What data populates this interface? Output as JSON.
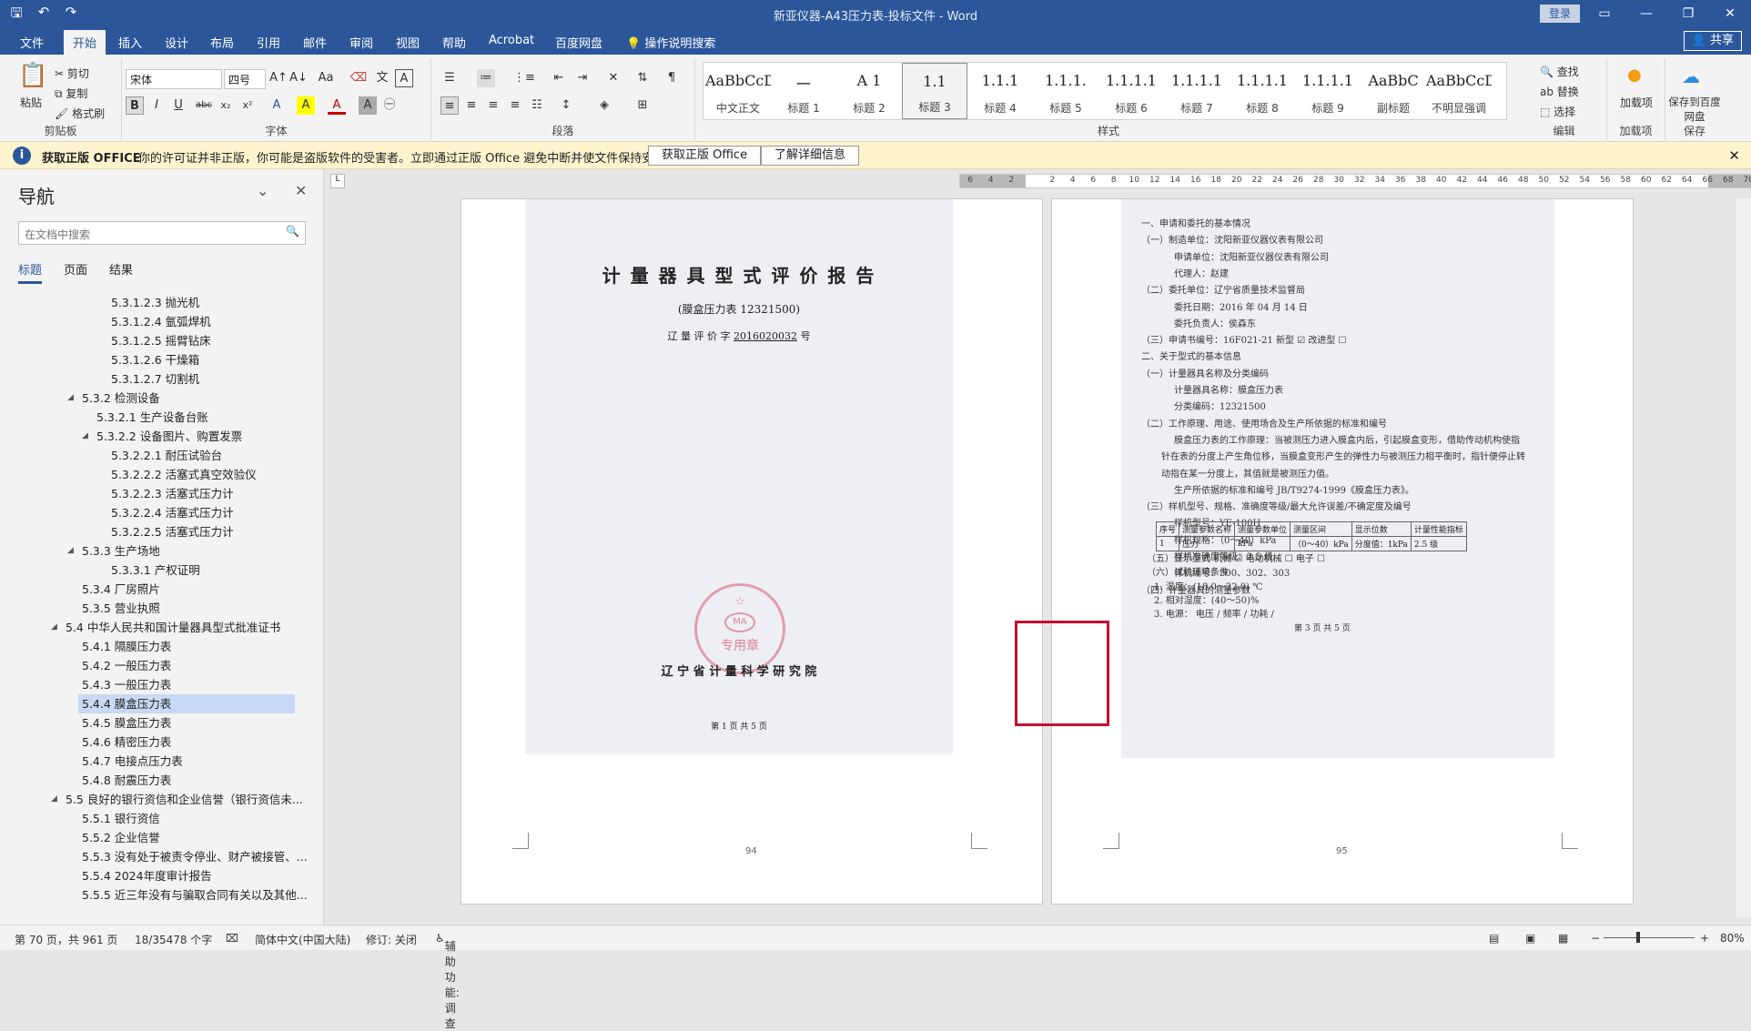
{
  "window": {
    "title": "新亚仪器-A43压力表-投标文件 - Word",
    "login": "登录"
  },
  "qat": {
    "save": "🖫",
    "undo": "↶",
    "redo": "↷"
  },
  "menu": {
    "tabs": [
      "文件",
      "开始",
      "插入",
      "设计",
      "布局",
      "引用",
      "邮件",
      "审阅",
      "视图",
      "帮助",
      "Acrobat",
      "百度网盘"
    ],
    "active": "开始",
    "tell_me": "操作说明搜索",
    "share": "共享"
  },
  "ribbon": {
    "clipboard": {
      "paste": "粘贴",
      "cut": "剪切",
      "copy": "复制",
      "format_painter": "格式刷",
      "label": "剪贴板"
    },
    "font": {
      "name": "宋体",
      "size": "四号",
      "label": "字体",
      "buttons": [
        "B",
        "I",
        "U",
        "abc",
        "x₂",
        "x²",
        "A",
        "A",
        "A",
        "A"
      ]
    },
    "paragraph": {
      "label": "段落"
    },
    "styles": {
      "label": "样式",
      "items": [
        {
          "preview": "AaBbCcDdI",
          "name": "中文正文"
        },
        {
          "preview": "一",
          "name": "标题 1"
        },
        {
          "preview": "A 1",
          "name": "标题 2"
        },
        {
          "preview": "1.1",
          "name": "标题 3"
        },
        {
          "preview": "1.1.1",
          "name": "标题 4"
        },
        {
          "preview": "1.1.1.",
          "name": "标题 5"
        },
        {
          "preview": "1.1.1.1",
          "name": "标题 6"
        },
        {
          "preview": "1.1.1.1",
          "name": "标题 7"
        },
        {
          "preview": "1.1.1.1",
          "name": "标题 8"
        },
        {
          "preview": "1.1.1.1",
          "name": "标题 9"
        },
        {
          "preview": "AaBbC",
          "name": "副标题"
        },
        {
          "preview": "AaBbCcD",
          "name": "不明显强调"
        }
      ],
      "selected": "标题 3"
    },
    "editing": {
      "find": "查找",
      "replace": "替换",
      "select": "选择",
      "label": "编辑"
    },
    "addins": {
      "btn": "加载项",
      "label": "加载项"
    },
    "save": {
      "btn": "保存到百度网盘",
      "label": "保存"
    }
  },
  "banner": {
    "bold": "获取正版 OFFICE",
    "text": "你的许可证并非正版，你可能是盗版软件的受害者。立即通过正版 Office 避免中断并使文件保持安全。",
    "btn1": "获取正版 Office",
    "btn2": "了解详细信息"
  },
  "nav": {
    "title": "导航",
    "search_placeholder": "在文档中搜索",
    "tabs": [
      "标题",
      "页面",
      "结果"
    ],
    "items": [
      {
        "t": "5.3.1.2.3 抛光机",
        "lvl": 5
      },
      {
        "t": "5.3.1.2.4 氩弧焊机",
        "lvl": 5
      },
      {
        "t": "5.3.1.2.5 摇臂钻床",
        "lvl": 5
      },
      {
        "t": "5.3.1.2.6 干燥箱",
        "lvl": 5
      },
      {
        "t": "5.3.1.2.7 切割机",
        "lvl": 5
      },
      {
        "t": "5.3.2 检测设备",
        "lvl": 2,
        "open": true
      },
      {
        "t": "5.3.2.1 生产设备台账",
        "lvl": 3
      },
      {
        "t": "5.3.2.2 设备图片、购置发票",
        "lvl": 3,
        "open": true
      },
      {
        "t": "5.3.2.2.1 耐压试验台",
        "lvl": 5
      },
      {
        "t": "5.3.2.2.2 活塞式真空效验仪",
        "lvl": 5
      },
      {
        "t": "5.3.2.2.3 活塞式压力计",
        "lvl": 5
      },
      {
        "t": "5.3.2.2.4 活塞式压力计",
        "lvl": 5
      },
      {
        "t": "5.3.2.2.5 活塞式压力计",
        "lvl": 5
      },
      {
        "t": "5.3.3 生产场地",
        "lvl": 2,
        "open": true
      },
      {
        "t": "5.3.3.1 产权证明",
        "lvl": 4
      },
      {
        "t": "5.3.4 厂房照片",
        "lvl": 2
      },
      {
        "t": "5.3.5 营业执照",
        "lvl": 2
      },
      {
        "t": "5.4 中华人民共和国计量器具型式批准证书",
        "lvl": 1,
        "open": true
      },
      {
        "t": "5.4.1 隔膜压力表",
        "lvl": 2
      },
      {
        "t": "5.4.2 一般压力表",
        "lvl": 2
      },
      {
        "t": "5.4.3 一般压力表",
        "lvl": 2
      },
      {
        "t": "5.4.4 膜盒压力表",
        "lvl": 2,
        "sel": true
      },
      {
        "t": "5.4.5 膜盒压力表",
        "lvl": 2
      },
      {
        "t": "5.4.6 精密压力表",
        "lvl": 2
      },
      {
        "t": "5.4.7 电接点压力表",
        "lvl": 2
      },
      {
        "t": "5.4.8 耐震压力表",
        "lvl": 2
      },
      {
        "t": "5.5 良好的银行资信和企业信誉（银行资信未...",
        "lvl": 1,
        "open": true
      },
      {
        "t": "5.5.1 银行资信",
        "lvl": 2
      },
      {
        "t": "5.5.2 企业信誉",
        "lvl": 2
      },
      {
        "t": "5.5.3 没有处于被责令停业、财产被接管、...",
        "lvl": 2
      },
      {
        "t": "5.5.4 2024年度审计报告",
        "lvl": 2
      },
      {
        "t": "5.5.5 近三年没有与骗取合同有关以及其他...",
        "lvl": 2
      }
    ]
  },
  "ruler": [
    "6",
    "4",
    "2",
    "",
    "2",
    "4",
    "6",
    "8",
    "10",
    "12",
    "14",
    "16",
    "18",
    "20",
    "22",
    "24",
    "26",
    "28",
    "30",
    "32",
    "34",
    "36",
    "38",
    "40",
    "42",
    "44",
    "46",
    "48",
    "50",
    "52",
    "54",
    "56",
    "58",
    "60",
    "62",
    "64",
    "66",
    "68",
    "70",
    "72"
  ],
  "page_left": {
    "title": "计 量 器 具 型 式 评 价 报 告",
    "sub": "(膜盒压力表 12321500)",
    "code_label": "辽 量 评 价 字",
    "code": "2016020032",
    "code_suffix": "号",
    "institute": "辽 宁 省 计 量 科 学 研 究 院",
    "pageinfo": "第 1 页  共 5 页",
    "stamp": "专用章",
    "number": "94"
  },
  "page_right": {
    "lines": [
      "一、申请和委托的基本情况",
      "（一）制造单位：沈阳新亚仪器仪表有限公司",
      "申请单位：沈阳新亚仪器仪表有限公司",
      "代理人：赵建",
      "（二）委托单位：辽宁省质量技术监督局",
      "委托日期：2016 年 04 月 14 日",
      "委托负责人：侯森东",
      "（三）申请书编号：16F021-21     新型  ☑    改进型  ☐",
      "二、关于型式的基本信息",
      "（一）计量器具名称及分类编码",
      "计量器具名称：膜盒压力表",
      "分类编码：12321500",
      "（二）工作原理、用途、使用场合及生产所依据的标准和编号",
      "膜盒压力表的工作原理：当被测压力进入膜盒内后，引起膜盒变形，借助传动机构使指",
      "针在表的分度上产生角位移，当膜盒变形产生的弹性力与被测压力相平衡时，指针便停止转",
      "动指在某一分度上，其值就是被测压力值。",
      "生产所依据的标准和编号 JB/T9274-1999《膜盒压力表》。",
      "（三）样机型号、规格、准确度等级/最大允许误差/不确定度及编号",
      "样机型号：YE-100H",
      "样机规格：（0～40）kPa",
      "样机准确度等级：2.5 级",
      "样机编号：300、302、303",
      "（四）计量器具的测量参数"
    ],
    "table_head": [
      "序号",
      "测量参数名称",
      "测量参数单位",
      "测量区间",
      "显示位数",
      "计量性能指标"
    ],
    "table_row": [
      "1",
      "压力",
      "kPa",
      "（0～40）kPa",
      "分度值：1kPa",
      "2.5 级"
    ],
    "lines2": [
      "（五）显示型式     机械  ☑     电动机械  ☐      电子  ☐",
      "（六）试验环境条件",
      "1. 温度：(18.0～22.0) ℃",
      "2. 相对湿度：(40～50)%",
      "3. 电源：           电压   /           频率   /           功耗   /"
    ],
    "pageinfo": "第 3 页  共 5 页",
    "number": "95"
  },
  "status": {
    "page": "第 70 页，共 961 页",
    "words": "18/35478 个字",
    "lang": "简体中文(中国大陆)",
    "track": "修订: 关闭",
    "access": "辅助功能: 调查",
    "zoom": "80%"
  },
  "colors": {
    "accent": "#2b579a",
    "banner": "#fff4ce",
    "highlight_box": "#c8102e"
  }
}
